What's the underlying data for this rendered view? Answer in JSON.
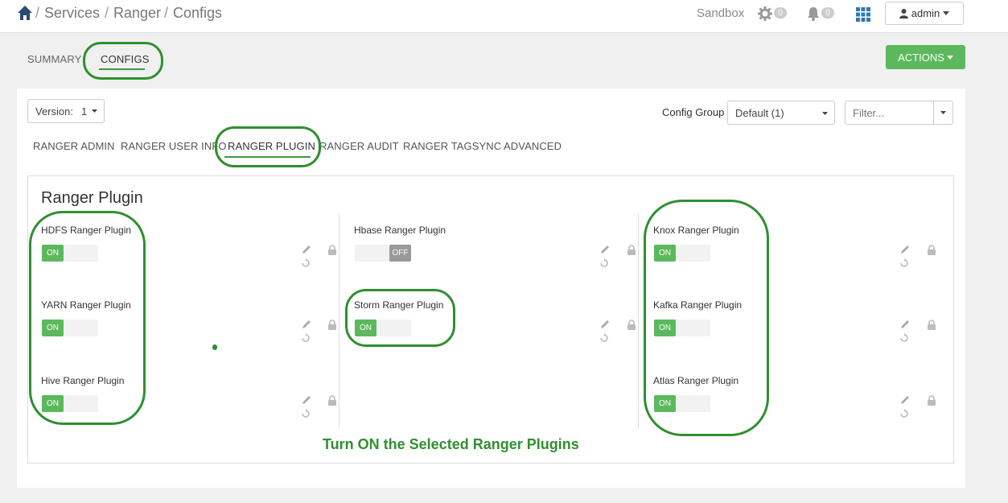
{
  "breadcrumb": {
    "items": [
      "Services",
      "Ranger",
      "Configs"
    ]
  },
  "header": {
    "cluster": "Sandbox",
    "ops_count": "0",
    "alerts_count": "0",
    "user": "admin"
  },
  "service_tabs": {
    "summary": "SUMMARY",
    "configs": "CONFIGS",
    "actions": "ACTIONS"
  },
  "toolbar": {
    "version_label": "Version:",
    "version_value": "1",
    "config_group_label": "Config Group",
    "config_group_value": "Default (1)",
    "filter_placeholder": "Filter..."
  },
  "config_tabs": [
    "RANGER ADMIN",
    "RANGER USER INFO",
    "RANGER PLUGIN",
    "RANGER AUDIT",
    "RANGER TAGSYNC",
    "ADVANCED"
  ],
  "section": {
    "title": "Ranger Plugin",
    "plugins": [
      {
        "label": "HDFS Ranger Plugin",
        "state": "ON"
      },
      {
        "label": "YARN Ranger Plugin",
        "state": "ON"
      },
      {
        "label": "Hive Ranger Plugin",
        "state": "ON"
      },
      {
        "label": "Hbase Ranger Plugin",
        "state": "OFF"
      },
      {
        "label": "Storm Ranger Plugin",
        "state": "ON"
      },
      {
        "label": "Knox Ranger Plugin",
        "state": "ON"
      },
      {
        "label": "Kafka Ranger Plugin",
        "state": "ON"
      },
      {
        "label": "Atlas Ranger Plugin",
        "state": "ON"
      }
    ]
  },
  "annotation": {
    "text": "Turn ON the Selected Ranger Plugins",
    "color": "#2f8f2f"
  },
  "colors": {
    "accent": "#5cb85c",
    "annotation": "#2f8f2f",
    "toggle_off": "#999999"
  }
}
